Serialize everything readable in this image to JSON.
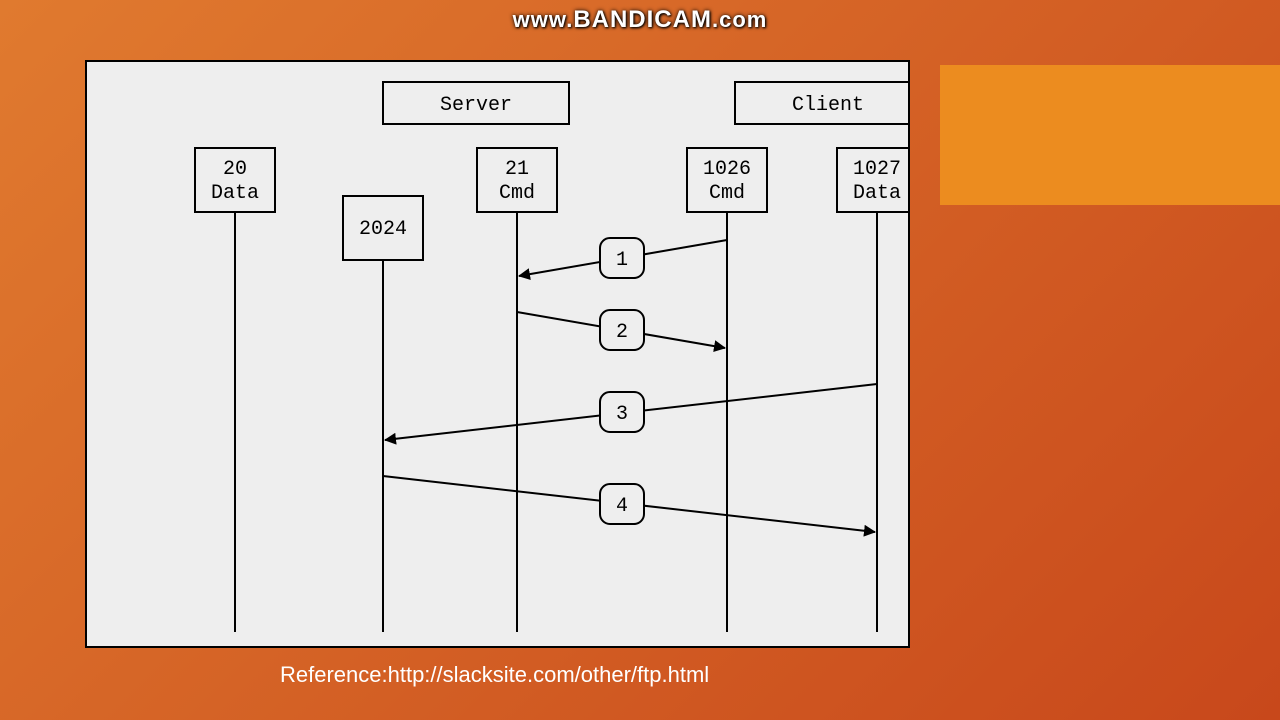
{
  "watermark": {
    "prefix": "www.",
    "brand": "BANDICAM",
    "suffix": ".com"
  },
  "headers": {
    "server": "Server",
    "client": "Client"
  },
  "ports": {
    "p20": {
      "line1": "20",
      "line2": "Data"
    },
    "p2024": {
      "line1": "2024",
      "line2": ""
    },
    "p21": {
      "line1": "21",
      "line2": "Cmd"
    },
    "p1026": {
      "line1": "1026",
      "line2": "Cmd"
    },
    "p1027": {
      "line1": "1027",
      "line2": "Data"
    }
  },
  "steps": {
    "s1": "1",
    "s2": "2",
    "s3": "3",
    "s4": "4"
  },
  "reference": "Reference:http://slacksite.com/other/ftp.html"
}
